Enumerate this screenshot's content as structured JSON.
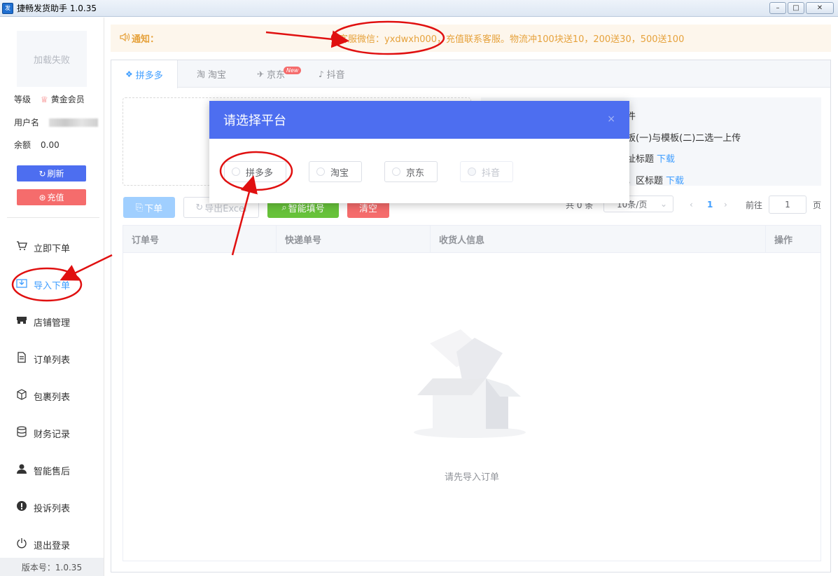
{
  "window": {
    "title": "捷畅发货助手 1.0.35",
    "app_icon_text": "发",
    "minimize": "–",
    "maximize": "□",
    "close": "✕"
  },
  "sidebar": {
    "avatar_text": "加载失败",
    "level_label": "等级",
    "level_value": "黄金会员",
    "username_label": "用户名",
    "balance_label": "余额",
    "balance_value": "0.00",
    "refresh_label": "刷新",
    "recharge_label": "充值",
    "nav": [
      {
        "label": "立即下单",
        "icon": "cart-icon"
      },
      {
        "label": "导入下单",
        "icon": "import-icon"
      },
      {
        "label": "店铺管理",
        "icon": "store-icon"
      },
      {
        "label": "订单列表",
        "icon": "document-icon"
      },
      {
        "label": "包裹列表",
        "icon": "package-icon"
      },
      {
        "label": "财务记录",
        "icon": "database-icon"
      },
      {
        "label": "智能售后",
        "icon": "user-icon"
      },
      {
        "label": "投诉列表",
        "icon": "warning-icon"
      },
      {
        "label": "退出登录",
        "icon": "power-icon"
      }
    ],
    "version": "版本号：1.0.35"
  },
  "notice": {
    "label": "通知：",
    "message": "客服微信：yxdwxh000，充值联系客服。物流冲100块送10，200送30，500送100"
  },
  "tabs": [
    {
      "label": "拼多多",
      "icon": "pdd-icon"
    },
    {
      "label": "淘宝",
      "icon": "taobao-icon"
    },
    {
      "label": "京东",
      "icon": "jd-icon",
      "badge": "New"
    },
    {
      "label": "抖音",
      "icon": "douyin-icon"
    }
  ],
  "instructions": {
    "line1": "件",
    "line2": "板(一)与模板(二)二选一上传",
    "line3": "址标题",
    "line4": "，区标题",
    "download": "下载"
  },
  "toolbar": {
    "order": "下单",
    "export": "导出Excel",
    "smart_fill": "智能填号",
    "clear": "清空"
  },
  "pagination": {
    "total": "共 0 条",
    "page_size": "10条/页",
    "current_page": "1",
    "goto_label": "前往",
    "goto_value": "1",
    "page_suffix": "页"
  },
  "table": {
    "columns": [
      "订单号",
      "快递单号",
      "收货人信息",
      "操作"
    ],
    "empty_text": "请先导入订单"
  },
  "dialog": {
    "title": "请选择平台",
    "close": "×",
    "options": [
      {
        "label": "拼多多",
        "disabled": false
      },
      {
        "label": "淘宝",
        "disabled": false
      },
      {
        "label": "京东",
        "disabled": false
      },
      {
        "label": "抖音",
        "disabled": true
      }
    ]
  },
  "colors": {
    "accent": "#4d6ef0",
    "annotation": "#e01010",
    "notice_text": "#e6a23c"
  }
}
